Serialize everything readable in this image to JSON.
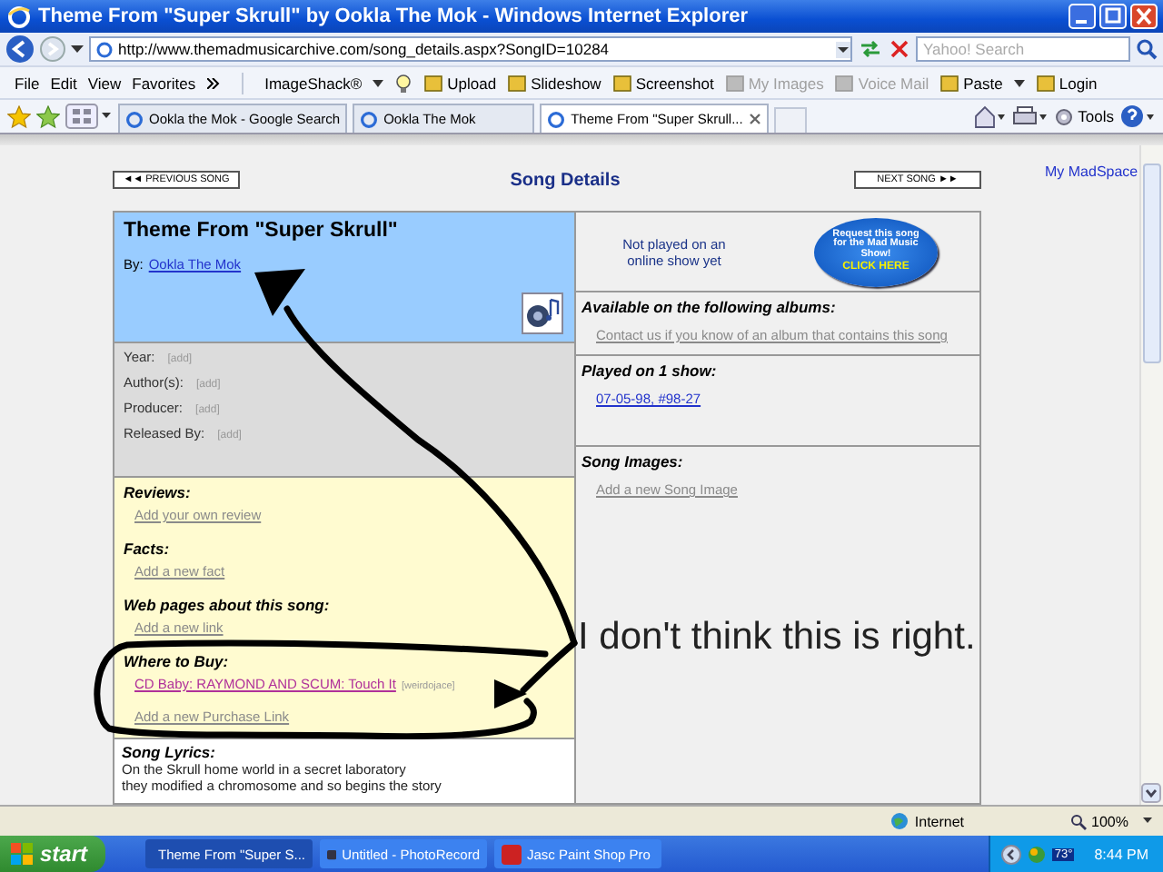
{
  "window": {
    "title": "Theme From \"Super Skrull\" by Ookla The Mok - Windows Internet Explorer"
  },
  "address_bar": {
    "url": "http://www.themadmusicarchive.com/song_details.aspx?SongID=10284",
    "search_placeholder": "Yahoo! Search"
  },
  "menu": [
    "File",
    "Edit",
    "View",
    "Favorites"
  ],
  "toolbar": [
    {
      "label": "ImageShack®",
      "disabled": false,
      "kind": "menu"
    },
    {
      "label": "Upload",
      "disabled": false,
      "kind": "button"
    },
    {
      "label": "Slideshow",
      "disabled": false,
      "kind": "button"
    },
    {
      "label": "Screenshot",
      "disabled": false,
      "kind": "button"
    },
    {
      "label": "My Images",
      "disabled": true,
      "kind": "button"
    },
    {
      "label": "Voice Mail",
      "disabled": true,
      "kind": "button"
    },
    {
      "label": "Paste",
      "disabled": false,
      "kind": "menu"
    },
    {
      "label": "Login",
      "disabled": false,
      "kind": "button"
    }
  ],
  "tabs": [
    {
      "label": "Ookla the Mok - Google Search",
      "selected": false
    },
    {
      "label": "Ookla The Mok",
      "selected": false
    },
    {
      "label": "Theme From \"Super Skrull...",
      "selected": true
    }
  ],
  "tools_label": "Tools",
  "page": {
    "previous_button": "◄◄ PREVIOUS SONG",
    "heading": "Song Details",
    "next_button": "NEXT SONG ►►",
    "my_madspace": "My MadSpace",
    "song": {
      "title": "Theme From \"Super Skrull\"",
      "by_label": "By:",
      "artist": "Ookla The Mok"
    },
    "fields": [
      {
        "label": "Year:",
        "value": "[add]"
      },
      {
        "label": "Author(s):",
        "value": "[add]"
      },
      {
        "label": "Producer:",
        "value": "[add]"
      },
      {
        "label": "Released By:",
        "value": "[add]"
      }
    ],
    "sections": [
      {
        "heading": "Reviews:",
        "links": [
          {
            "text": "Add your own review",
            "kind": "add"
          }
        ]
      },
      {
        "heading": "Facts:",
        "links": [
          {
            "text": "Add a new fact",
            "kind": "add"
          }
        ]
      },
      {
        "heading": "Web pages about this song:",
        "links": [
          {
            "text": "Add a new link",
            "kind": "add"
          }
        ]
      },
      {
        "heading": "Where to Buy:",
        "links": [
          {
            "text": "CD Baby: RAYMOND AND SCUM: Touch It",
            "kind": "purchase",
            "note": "[weirdojace]"
          },
          {
            "text": "Add a new Purchase Link",
            "kind": "add"
          }
        ]
      }
    ],
    "lyrics": {
      "heading": "Song Lyrics:",
      "lines": [
        "On the Skrull home world in a secret laboratory",
        "they modified a chromosome and so begins the story"
      ]
    },
    "play_status": "Not played on an online show yet",
    "request_button": {
      "text": "Request this song for the Mad Music Show!",
      "cta": "CLICK HERE"
    },
    "right_sections": [
      {
        "heading": "Available on the following albums:",
        "link": "Contact us if you know of an album that contains this song",
        "kind": "add"
      },
      {
        "heading": "Played on 1 show:",
        "link": "07-05-98, #98-27",
        "kind": "show"
      },
      {
        "heading": "Song Images:",
        "link": "Add a new Song Image",
        "kind": "add"
      }
    ]
  },
  "annotation": "I don't think this is right.",
  "status_bar": {
    "zone": "Internet",
    "zoom": "100%"
  },
  "taskbar": {
    "start": "start",
    "tasks": [
      {
        "label": "Theme From \"Super S...",
        "selected": true
      },
      {
        "label": "Untitled - PhotoRecord",
        "selected": false
      },
      {
        "label": "Jasc Paint Shop Pro",
        "selected": false
      }
    ],
    "temperature": "73°",
    "clock": "8:44 PM"
  }
}
